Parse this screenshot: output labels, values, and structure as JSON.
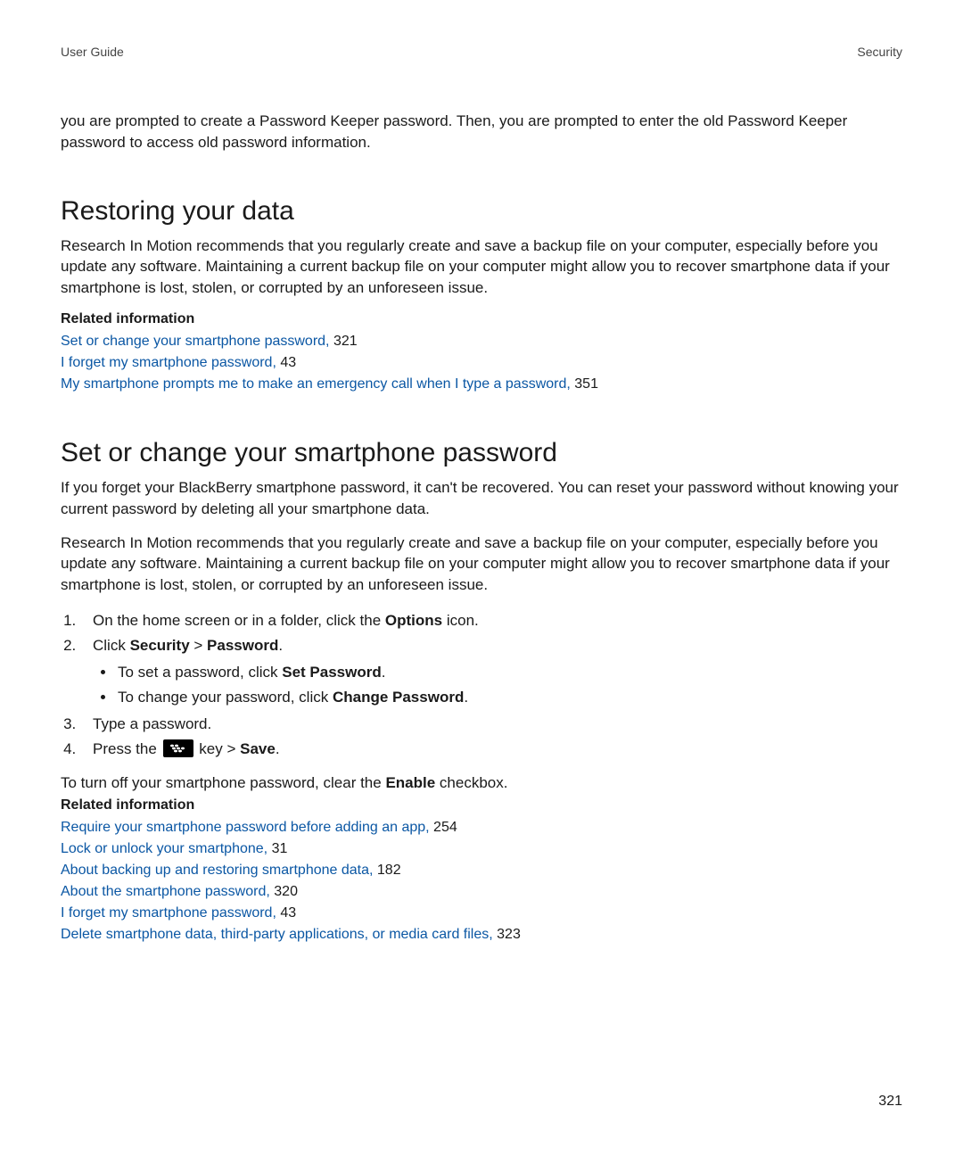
{
  "header": {
    "left": "User Guide",
    "right": "Security"
  },
  "intro_paragraph": "you are prompted to create a Password Keeper password. Then, you are prompted to enter the old Password Keeper password to access old password information.",
  "section1": {
    "heading": "Restoring your data",
    "paragraph": "Research In Motion recommends that you regularly create and save a backup file on your computer, especially before you update any software. Maintaining a current backup file on your computer might allow you to recover smartphone data if your smartphone is lost, stolen, or corrupted by an unforeseen issue.",
    "related_heading": "Related information",
    "related": [
      {
        "text": "Set or change your smartphone password,",
        "page": "321"
      },
      {
        "text": "I forget my smartphone password,",
        "page": "43"
      },
      {
        "text": "My smartphone prompts me to make an emergency call when I type a password,",
        "page": "351"
      }
    ]
  },
  "section2": {
    "heading": "Set or change your smartphone password",
    "paragraph1": "If you forget your BlackBerry smartphone password, it can't be recovered. You can reset your password without knowing your current password by deleting all your smartphone data.",
    "paragraph2": "Research In Motion recommends that you regularly create and save a backup file on your computer, especially before you update any software. Maintaining a current backup file on your computer might allow you to recover smartphone data if your smartphone is lost, stolen, or corrupted by an unforeseen issue.",
    "steps": {
      "s1_pre": "On the home screen or in a folder, click the ",
      "s1_bold": "Options",
      "s1_post": " icon.",
      "s2_pre": "Click ",
      "s2_b1": "Security",
      "s2_mid": " > ",
      "s2_b2": "Password",
      "s2_post": ".",
      "sub1_pre": "To set a password, click ",
      "sub1_bold": "Set Password",
      "sub1_post": ".",
      "sub2_pre": "To change your password, click ",
      "sub2_bold": "Change Password",
      "sub2_post": ".",
      "s3": "Type a password.",
      "s4_pre": "Press the ",
      "s4_mid": " key > ",
      "s4_bold": "Save",
      "s4_post": "."
    },
    "turnoff_pre": "To turn off your smartphone password, clear the ",
    "turnoff_bold": "Enable",
    "turnoff_post": " checkbox.",
    "related_heading": "Related information",
    "related": [
      {
        "text": "Require your smartphone password before adding an app,",
        "page": "254"
      },
      {
        "text": "Lock or unlock your smartphone,",
        "page": "31"
      },
      {
        "text": "About backing up and restoring smartphone data,",
        "page": "182"
      },
      {
        "text": "About the smartphone password,",
        "page": "320"
      },
      {
        "text": "I forget my smartphone password,",
        "page": "43"
      },
      {
        "text": "Delete smartphone data, third-party applications, or media card files,",
        "page": "323"
      }
    ]
  },
  "page_number": "321"
}
